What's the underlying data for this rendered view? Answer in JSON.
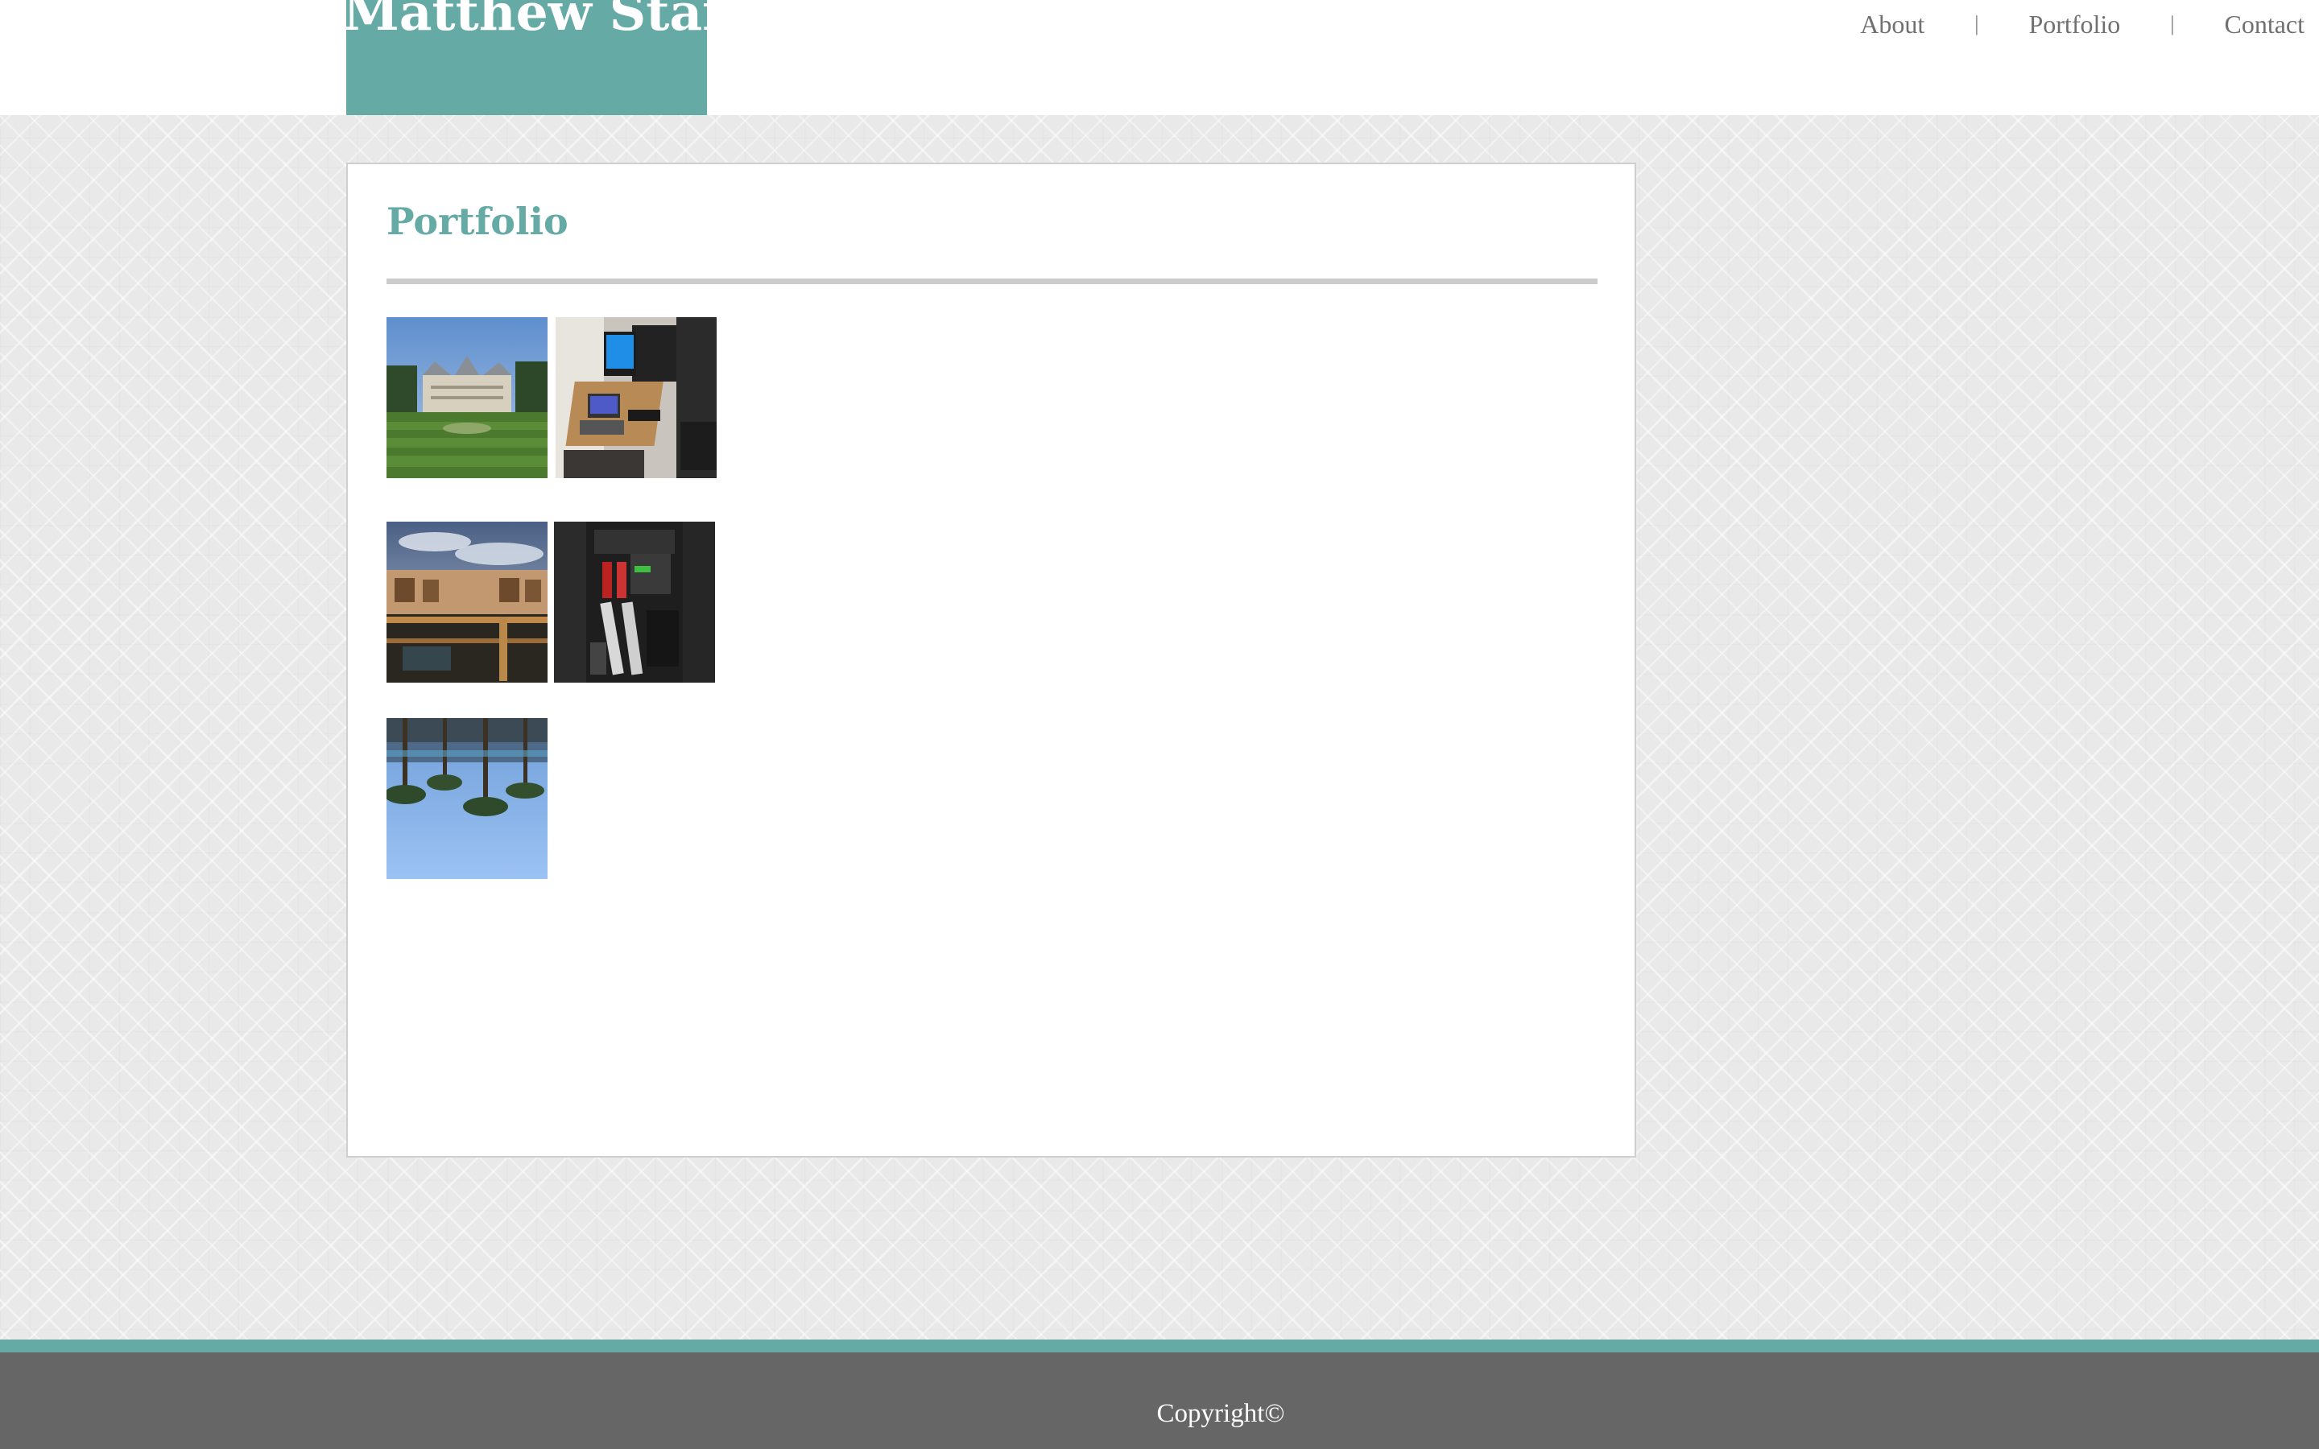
{
  "site": {
    "name": "Matthew Starr"
  },
  "nav": {
    "items": [
      "About",
      "Portfolio",
      "Contact"
    ],
    "separator": "|"
  },
  "main": {
    "heading": "Portfolio",
    "images": [
      {
        "subject": "mansion-lawn-photo"
      },
      {
        "subject": "computer-desk-photo"
      },
      {
        "subject": "mall-interior-photo"
      },
      {
        "subject": "pc-internals-photo"
      },
      {
        "subject": "upside-down-palm-trees-photo"
      }
    ]
  },
  "footer": {
    "copyright": "Copyright©"
  },
  "colors": {
    "accent": "#66aaa6",
    "footer_bg": "#666666",
    "nav_text": "#707070"
  }
}
